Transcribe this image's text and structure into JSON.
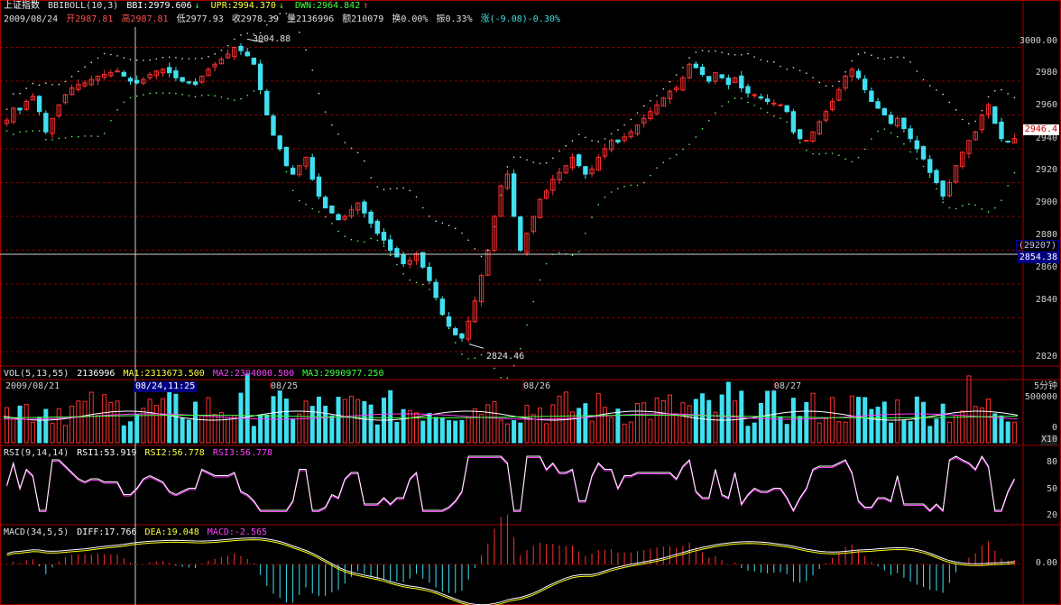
{
  "header": {
    "title": "上证指数",
    "indicator": "BBIBOLL(10,3)",
    "bbi": "BBI:2979.606",
    "upr": "UPR:2994.370",
    "dwn": "DWN:2964.842",
    "arrow_down": "↓",
    "arrow_up": "↑"
  },
  "quote": {
    "date": "2009/08/24",
    "open": "开2987.81",
    "high": "高2987.81",
    "low": "低2977.93",
    "close": "收2978.39",
    "volume": "量2136996",
    "amount": "额210079",
    "turnover": "换0.00%",
    "amplitude": "振0.33%",
    "change": "涨(-9.08)-0.30%"
  },
  "vol_header": {
    "name": "VOL(5,13,55)",
    "value": "2136996",
    "ma1": "MA1:2313673.500",
    "ma2": "MA2:2304000.500",
    "ma3": "MA3:2990977.250"
  },
  "rsi_header": {
    "name": "RSI(9,14,14)",
    "rsi1": "RSI1:53.919",
    "rsi2": "RSI2:56.778",
    "rsi3": "RSI3:56.778"
  },
  "macd_header": {
    "name": "MACD(34,5,5)",
    "diff": "DIFF:17.766",
    "dea": "DEA:19.048",
    "macd": "MACD:-2.565"
  },
  "price_axis": [
    "3000.00",
    "2980",
    "2960",
    "2940",
    "2920",
    "2900",
    "2880",
    "2860",
    "2840",
    "2820"
  ],
  "vol_axis": [
    "500000",
    "0"
  ],
  "vol_unit": "X10",
  "rsi_axis": [
    "80",
    "50",
    "20"
  ],
  "macd_axis": [
    "0.00"
  ],
  "current_price": "2946.4",
  "cursor_price": "2854.38",
  "cursor_count": "(29207)",
  "date_labels": [
    "2009/08/21",
    "08/24,11:25",
    "08/25",
    "08/26",
    "08/27"
  ],
  "period": "5分钟",
  "annotations": {
    "high": "3004.88",
    "low": "2824.46"
  },
  "colors": {
    "up": "#ff3030",
    "down": "#40e0f0",
    "grid": "#8b0000",
    "axis": "#a00000",
    "white": "#ffffff",
    "yellow": "#ffff00",
    "magenta": "#ff40ff",
    "green": "#40ff40"
  },
  "chart_data": {
    "type": "candlestick",
    "unit": "5-minute bars, 上证指数",
    "ylim": [
      2812,
      3012
    ],
    "closes": [
      2957,
      2964,
      2963,
      2968,
      2971,
      2962,
      2950,
      2958,
      2966,
      2972,
      2976,
      2978,
      2979,
      2981,
      2983,
      2984,
      2985,
      2986,
      2983,
      2980,
      2979,
      2981,
      2984,
      2986,
      2987,
      2985,
      2982,
      2980,
      2979,
      2978,
      2983,
      2987,
      2990,
      2993,
      2996,
      3000,
      2998,
      2995,
      2990,
      2975,
      2960,
      2948,
      2940,
      2930,
      2925,
      2930,
      2935,
      2922,
      2912,
      2905,
      2902,
      2898,
      2900,
      2904,
      2908,
      2902,
      2896,
      2890,
      2886,
      2880,
      2876,
      2872,
      2874,
      2878,
      2870,
      2862,
      2852,
      2842,
      2835,
      2830,
      2828,
      2838,
      2850,
      2865,
      2880,
      2900,
      2918,
      2925,
      2900,
      2880,
      2890,
      2900,
      2910,
      2915,
      2922,
      2926,
      2930,
      2935,
      2930,
      2925,
      2928,
      2935,
      2940,
      2945,
      2944,
      2947,
      2950,
      2954,
      2958,
      2962,
      2966,
      2970,
      2974,
      2976,
      2982,
      2990,
      2988,
      2984,
      2980,
      2985,
      2982,
      2978,
      2982,
      2976,
      2973,
      2972,
      2970,
      2968,
      2967,
      2966,
      2962,
      2950,
      2946,
      2945,
      2950,
      2956,
      2962,
      2968,
      2975,
      2983,
      2987,
      2982,
      2975,
      2968,
      2964,
      2960,
      2955,
      2958,
      2952,
      2946,
      2940,
      2934,
      2926,
      2920,
      2912,
      2920,
      2930,
      2938,
      2945,
      2950,
      2960,
      2966,
      2955,
      2946,
      2944,
      2946
    ]
  }
}
